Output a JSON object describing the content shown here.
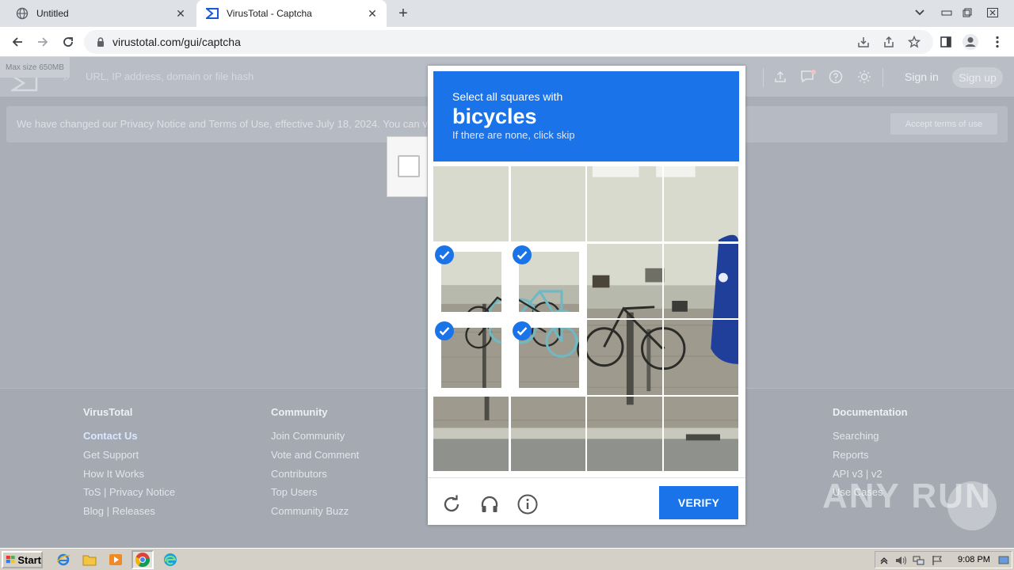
{
  "browser": {
    "tabs": [
      {
        "title": "Untitled",
        "active": false
      },
      {
        "title": "VirusTotal - Captcha",
        "active": true
      }
    ],
    "url": "virustotal.com/gui/captcha"
  },
  "virustotal": {
    "max_size_badge": "Max size 650MB",
    "search_placeholder": "URL, IP address, domain or file hash",
    "sign_in": "Sign in",
    "sign_up": "Sign up",
    "notice_text": "We have changed our Privacy Notice and Terms of Use, effective July 18, 2024. You can v",
    "accept_button": "Accept terms of use",
    "footer": {
      "col1": {
        "heading": "VirusTotal",
        "links": [
          "Contact Us",
          "Get Support",
          "How It Works",
          "ToS | Privacy Notice",
          "Blog | Releases"
        ]
      },
      "col2": {
        "heading": "Community",
        "links": [
          "Join Community",
          "Vote and Comment",
          "Contributors",
          "Top Users",
          "Community Buzz"
        ]
      },
      "col3": {
        "heading": "Documentation",
        "links": [
          "Searching",
          "Reports",
          "API v3 | v2",
          "Use Cases"
        ]
      }
    }
  },
  "captcha": {
    "prompt": "Select all squares with",
    "object": "bicycles",
    "hint": "If there are none, click skip",
    "verify_label": "VERIFY",
    "selected_tiles": [
      4,
      5,
      8,
      9
    ],
    "accent_color": "#1a73e8"
  },
  "watermark": "ANY RUN",
  "taskbar": {
    "start_label": "Start",
    "clock": "9:08 PM"
  }
}
